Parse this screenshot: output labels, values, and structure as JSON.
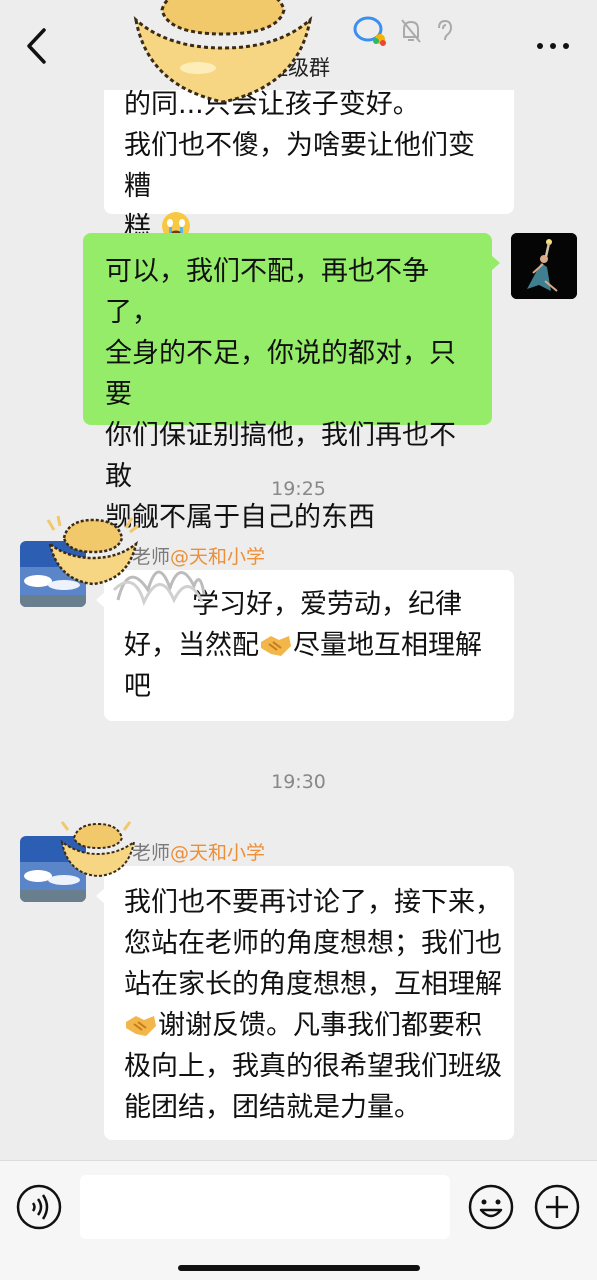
{
  "header": {
    "title": "班级群",
    "back_icon": "chevron-left-icon",
    "more_icon": "more-dots-icon"
  },
  "messages": [
    {
      "side": "left",
      "lines": [
        "的同...只会让孩子变好。",
        "我们也不傻，为啥要让他们变糟",
        "糕"
      ],
      "emoji_after": "crying-face-icon"
    },
    {
      "side": "right",
      "lines": [
        "可以，我们不配，再也不争了，",
        "全身的不足，你说的都对，只要",
        "你们保证别搞他，我们再也不敢",
        "觊觎不属于自己的东西"
      ]
    }
  ],
  "time1": "19:25",
  "msg3": {
    "sender_role": "老师",
    "sender_school": "@天和小学",
    "lines": [
      "学习好，爱劳动，纪律",
      "好，当然配",
      "尽量地互相理解",
      "吧"
    ]
  },
  "time2": "19:30",
  "msg4": {
    "sender_role": "老师",
    "sender_school": "@天和小学",
    "lines": [
      "我们也不要再讨论了，接下来，",
      "您站在老师的角度想想；我们也",
      "站在家长的角度想想，互相理解",
      "谢谢反馈。凡事我们都要积",
      "极向上，我真的很希望我们班级",
      "能团结，团结就是力量。"
    ]
  },
  "colors": {
    "background": "#ededed",
    "self_bubble": "#95ec69",
    "other_bubble": "#ffffff",
    "school_tag": "#ec8f37"
  }
}
